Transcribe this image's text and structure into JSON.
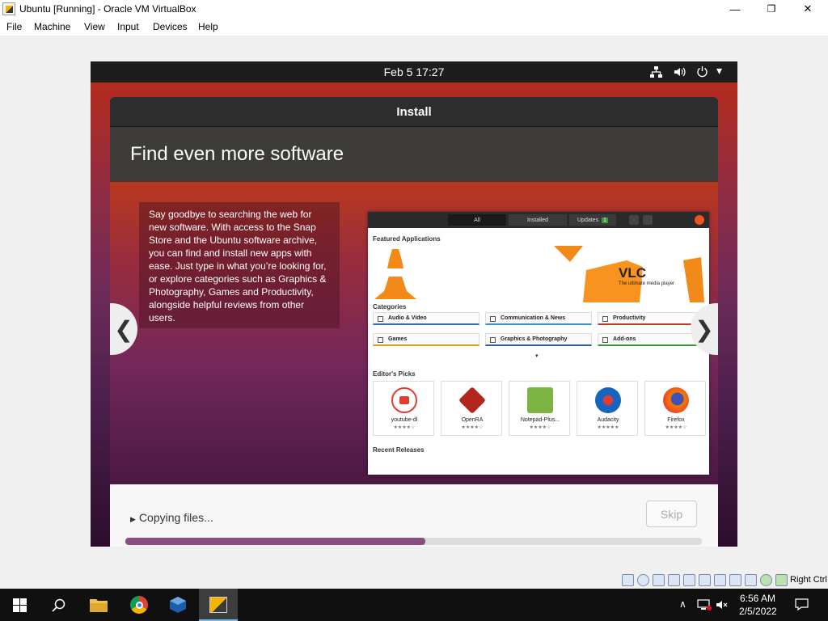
{
  "window": {
    "title": "Ubuntu [Running] - Oracle VM VirtualBox",
    "minimize": "—",
    "maximize": "❐",
    "close": "✕"
  },
  "menu": [
    "File",
    "Machine",
    "View",
    "Input",
    "Devices",
    "Help"
  ],
  "guest": {
    "topbar": {
      "datetime": "Feb 5  17:27",
      "network_icon": "network-icon",
      "volume_icon": "volume-icon",
      "power_icon": "power-icon",
      "dropdown": "▾"
    },
    "installer": {
      "title": "Install",
      "heading": "Find even more software",
      "description": "Say goodbye to searching the web for new software. With access to the Snap Store and the Ubuntu software archive, you can find and install new apps with ease. Just type in what you’re looking for, or explore categories such as Graphics & Photography, Games and Productivity, alongside helpful reviews from other users.",
      "prev_arrow": "❮",
      "next_arrow": "❯",
      "status": "Copying files...",
      "skip": "Skip",
      "progress": 0.52
    },
    "software_center": {
      "tabs": [
        "All",
        "Installed",
        "Updates"
      ],
      "updates_count": "1",
      "featured_label": "Featured Applications",
      "featured_app": "VLC",
      "featured_tagline": "The ultimate media player",
      "categories_label": "Categories",
      "categories": [
        {
          "label": "Audio & Video",
          "color": "#2f6db5"
        },
        {
          "label": "Communication & News",
          "color": "#3d8fd1"
        },
        {
          "label": "Productivity",
          "color": "#c0392b"
        },
        {
          "label": "Games",
          "color": "#d4a017"
        },
        {
          "label": "Graphics & Photography",
          "color": "#2e5f9e"
        },
        {
          "label": "Add-ons",
          "color": "#3c9a3c"
        }
      ],
      "editors_label": "Editor's Picks",
      "picks": [
        {
          "name": "youtube-dl",
          "stars": "★★★★☆",
          "color": "#e03c31"
        },
        {
          "name": "OpenRA",
          "stars": "★★★★☆",
          "color": "#b3261e"
        },
        {
          "name": "Notepad-Plus...",
          "stars": "★★★★☆",
          "color": "#7cb342"
        },
        {
          "name": "Audacity",
          "stars": "★★★★★",
          "color": "#1565c0"
        },
        {
          "name": "Firefox",
          "stars": "★★★★☆",
          "color": "#f57c00"
        }
      ],
      "recent_label": "Recent Releases"
    }
  },
  "statusbar": {
    "right_ctrl": "Right Ctrl"
  },
  "taskbar": {
    "time": "6:56 AM",
    "date": "2/5/2022"
  }
}
